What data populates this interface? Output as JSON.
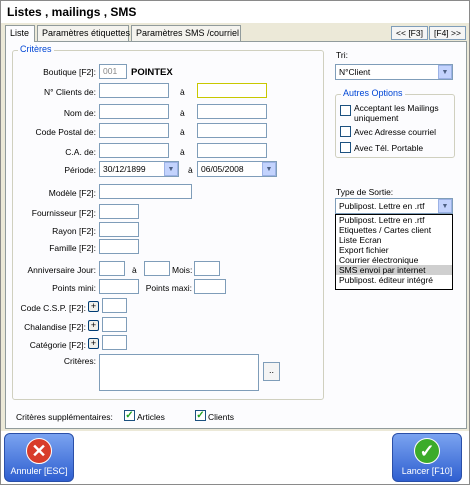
{
  "window": {
    "title": "Listes , mailings , SMS"
  },
  "tabs": [
    {
      "label": "Liste"
    },
    {
      "label": "Paramètres étiquettes"
    },
    {
      "label": "Paramètres SMS /courriel"
    }
  ],
  "nav": {
    "prev_label": "<< [F3]",
    "next_label": "[F4] >>"
  },
  "criteres": {
    "legend": "Critères",
    "boutique_label": "Boutique [F2]:",
    "boutique_code": "001",
    "boutique_name": "POINTEX",
    "nclients_label": "N° Clients de:",
    "nom_label": "Nom de:",
    "cp_label": "Code Postal de:",
    "ca_label": "C.A. de:",
    "periode_label": "Période:",
    "a_label": "à",
    "periode_from": "30/12/1899",
    "periode_to": "06/05/2008",
    "modele_label": "Modèle [F2]:",
    "fournisseur_label": "Fournisseur [F2]:",
    "rayon_label": "Rayon [F2]:",
    "famille_label": "Famille [F2]:",
    "anniv_label": "Anniversaire Jour:",
    "mois_label": "Mois:",
    "points_mini_label": "Points mini:",
    "points_maxi_label": "Points maxi:",
    "csp_label": "Code C.S.P. [F2]:",
    "chalandise_label": "Chalandise [F2]:",
    "categorie_label": "Catégorie [F2]:",
    "criteres_label": "Critères:",
    "plus": "+",
    "dots": ".."
  },
  "tri": {
    "label": "Tri:",
    "value": "N°Client"
  },
  "autres": {
    "legend": "Autres Options",
    "opt1": "Acceptant les Mailings uniquement",
    "opt2": "Avec Adresse courriel",
    "opt3": "Avec Tél. Portable"
  },
  "sortie": {
    "label": "Type de Sortie:",
    "value": "Publipost. Lettre en .rtf",
    "options": [
      "Publipost. Lettre en .rtf",
      "Etiquettes / Cartes client",
      "Liste Ecran",
      "Export fichier",
      "Courrier électronique",
      "SMS envoi par internet",
      "Publipost. éditeur intégré"
    ]
  },
  "supp": {
    "label": "Critères supplémentaires:",
    "articles": "Articles",
    "clients": "Clients",
    "check": "✓"
  },
  "buttons": {
    "cancel_label": "Annuler [ESC]",
    "cancel_icon": "✕",
    "launch_label": "Lancer [F10]",
    "launch_icon": "✓"
  }
}
